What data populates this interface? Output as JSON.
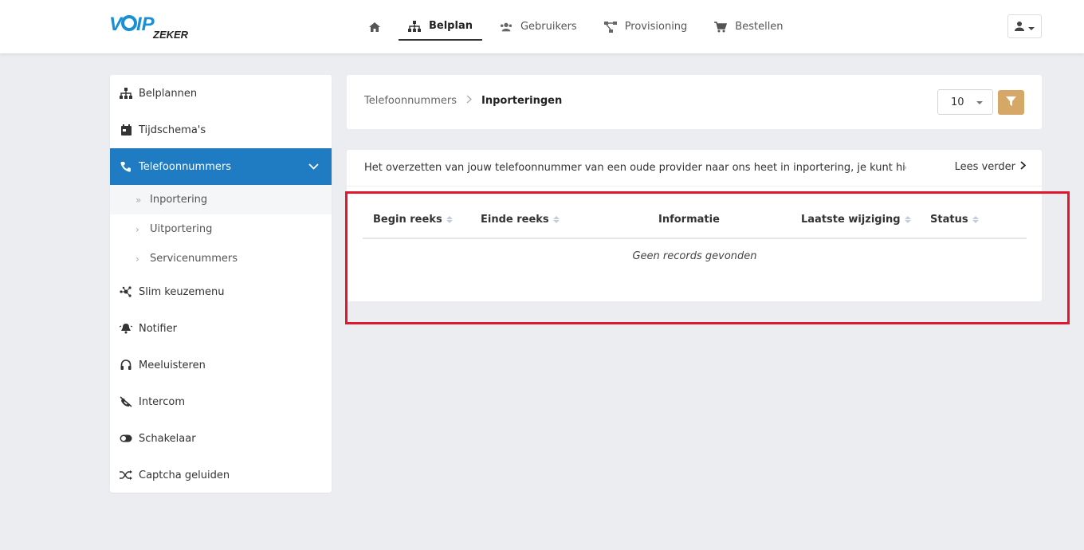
{
  "app": {
    "logo_text_main": "VOIP",
    "logo_text_sub": "ZEKER"
  },
  "nav": {
    "items": [
      {
        "label": "",
        "icon": "home-icon"
      },
      {
        "label": "Belplan",
        "icon": "sitemap-icon",
        "active": true
      },
      {
        "label": "Gebruikers",
        "icon": "users-icon"
      },
      {
        "label": "Provisioning",
        "icon": "network-icon"
      },
      {
        "label": "Bestellen",
        "icon": "cart-icon"
      }
    ]
  },
  "sidebar": {
    "items": [
      {
        "label": "Belplannen",
        "icon": "sitemap-icon"
      },
      {
        "label": "Tijdschema's",
        "icon": "calendar-icon"
      },
      {
        "label": "Telefoonnummers",
        "icon": "phone-icon",
        "active": true
      },
      {
        "label": "Slim keuzemenu",
        "icon": "nodes-icon"
      },
      {
        "label": "Notifier",
        "icon": "bell-icon"
      },
      {
        "label": "Meeluisteren",
        "icon": "headphones-icon"
      },
      {
        "label": "Intercom",
        "icon": "phone-slash-icon"
      },
      {
        "label": "Schakelaar",
        "icon": "toggle-icon"
      },
      {
        "label": "Captcha geluiden",
        "icon": "shuffle-icon"
      }
    ],
    "subitems": [
      {
        "label": "Inportering",
        "active": true
      },
      {
        "label": "Uitportering"
      },
      {
        "label": "Servicenummers"
      }
    ]
  },
  "breadcrumb": {
    "parent": "Telefoonnummers",
    "current": "Inporteringen"
  },
  "controls": {
    "per_page": "10"
  },
  "info": {
    "text": "Het overzetten van jouw telefoonnummer van een oude provider naar ons heet in inportering, je kunt hier de s...",
    "read_more": "Lees verder"
  },
  "table": {
    "columns": [
      "Begin reeks",
      "Einde reeks",
      "Informatie",
      "Laatste wijziging",
      "Status"
    ],
    "empty_text": "Geen records gevonden"
  },
  "colors": {
    "accent": "#1f7cc3",
    "filter_button": "#d6a868",
    "highlight": "#e0182d"
  }
}
